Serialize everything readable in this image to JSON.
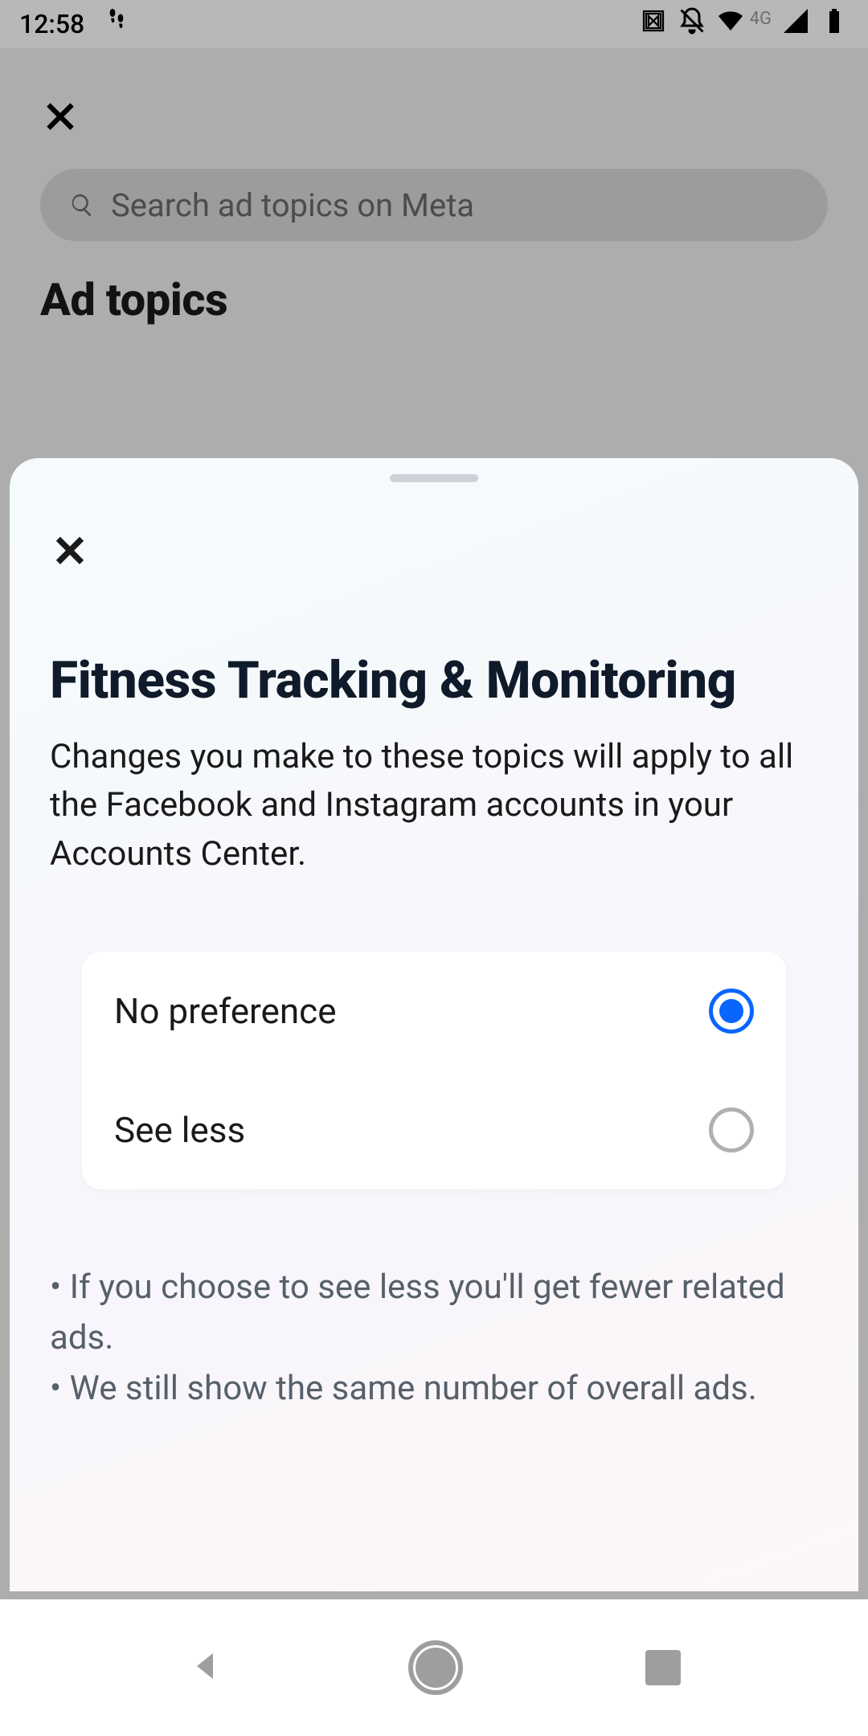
{
  "status": {
    "time": "12:58",
    "network_label": "4G"
  },
  "back_page": {
    "search_placeholder": "Search ad topics on Meta",
    "title": "Ad topics"
  },
  "sheet": {
    "title": "Fitness Tracking & Monitoring",
    "description": "Changes you make to these topics will apply to all the Facebook and Instagram accounts in your Accounts Center.",
    "options": {
      "no_preference": "No preference",
      "see_less": "See less",
      "selected": "no_preference"
    },
    "note1": "• If you choose to see less you'll get fewer related ads.",
    "note2": "• We still show the same number of overall ads."
  }
}
